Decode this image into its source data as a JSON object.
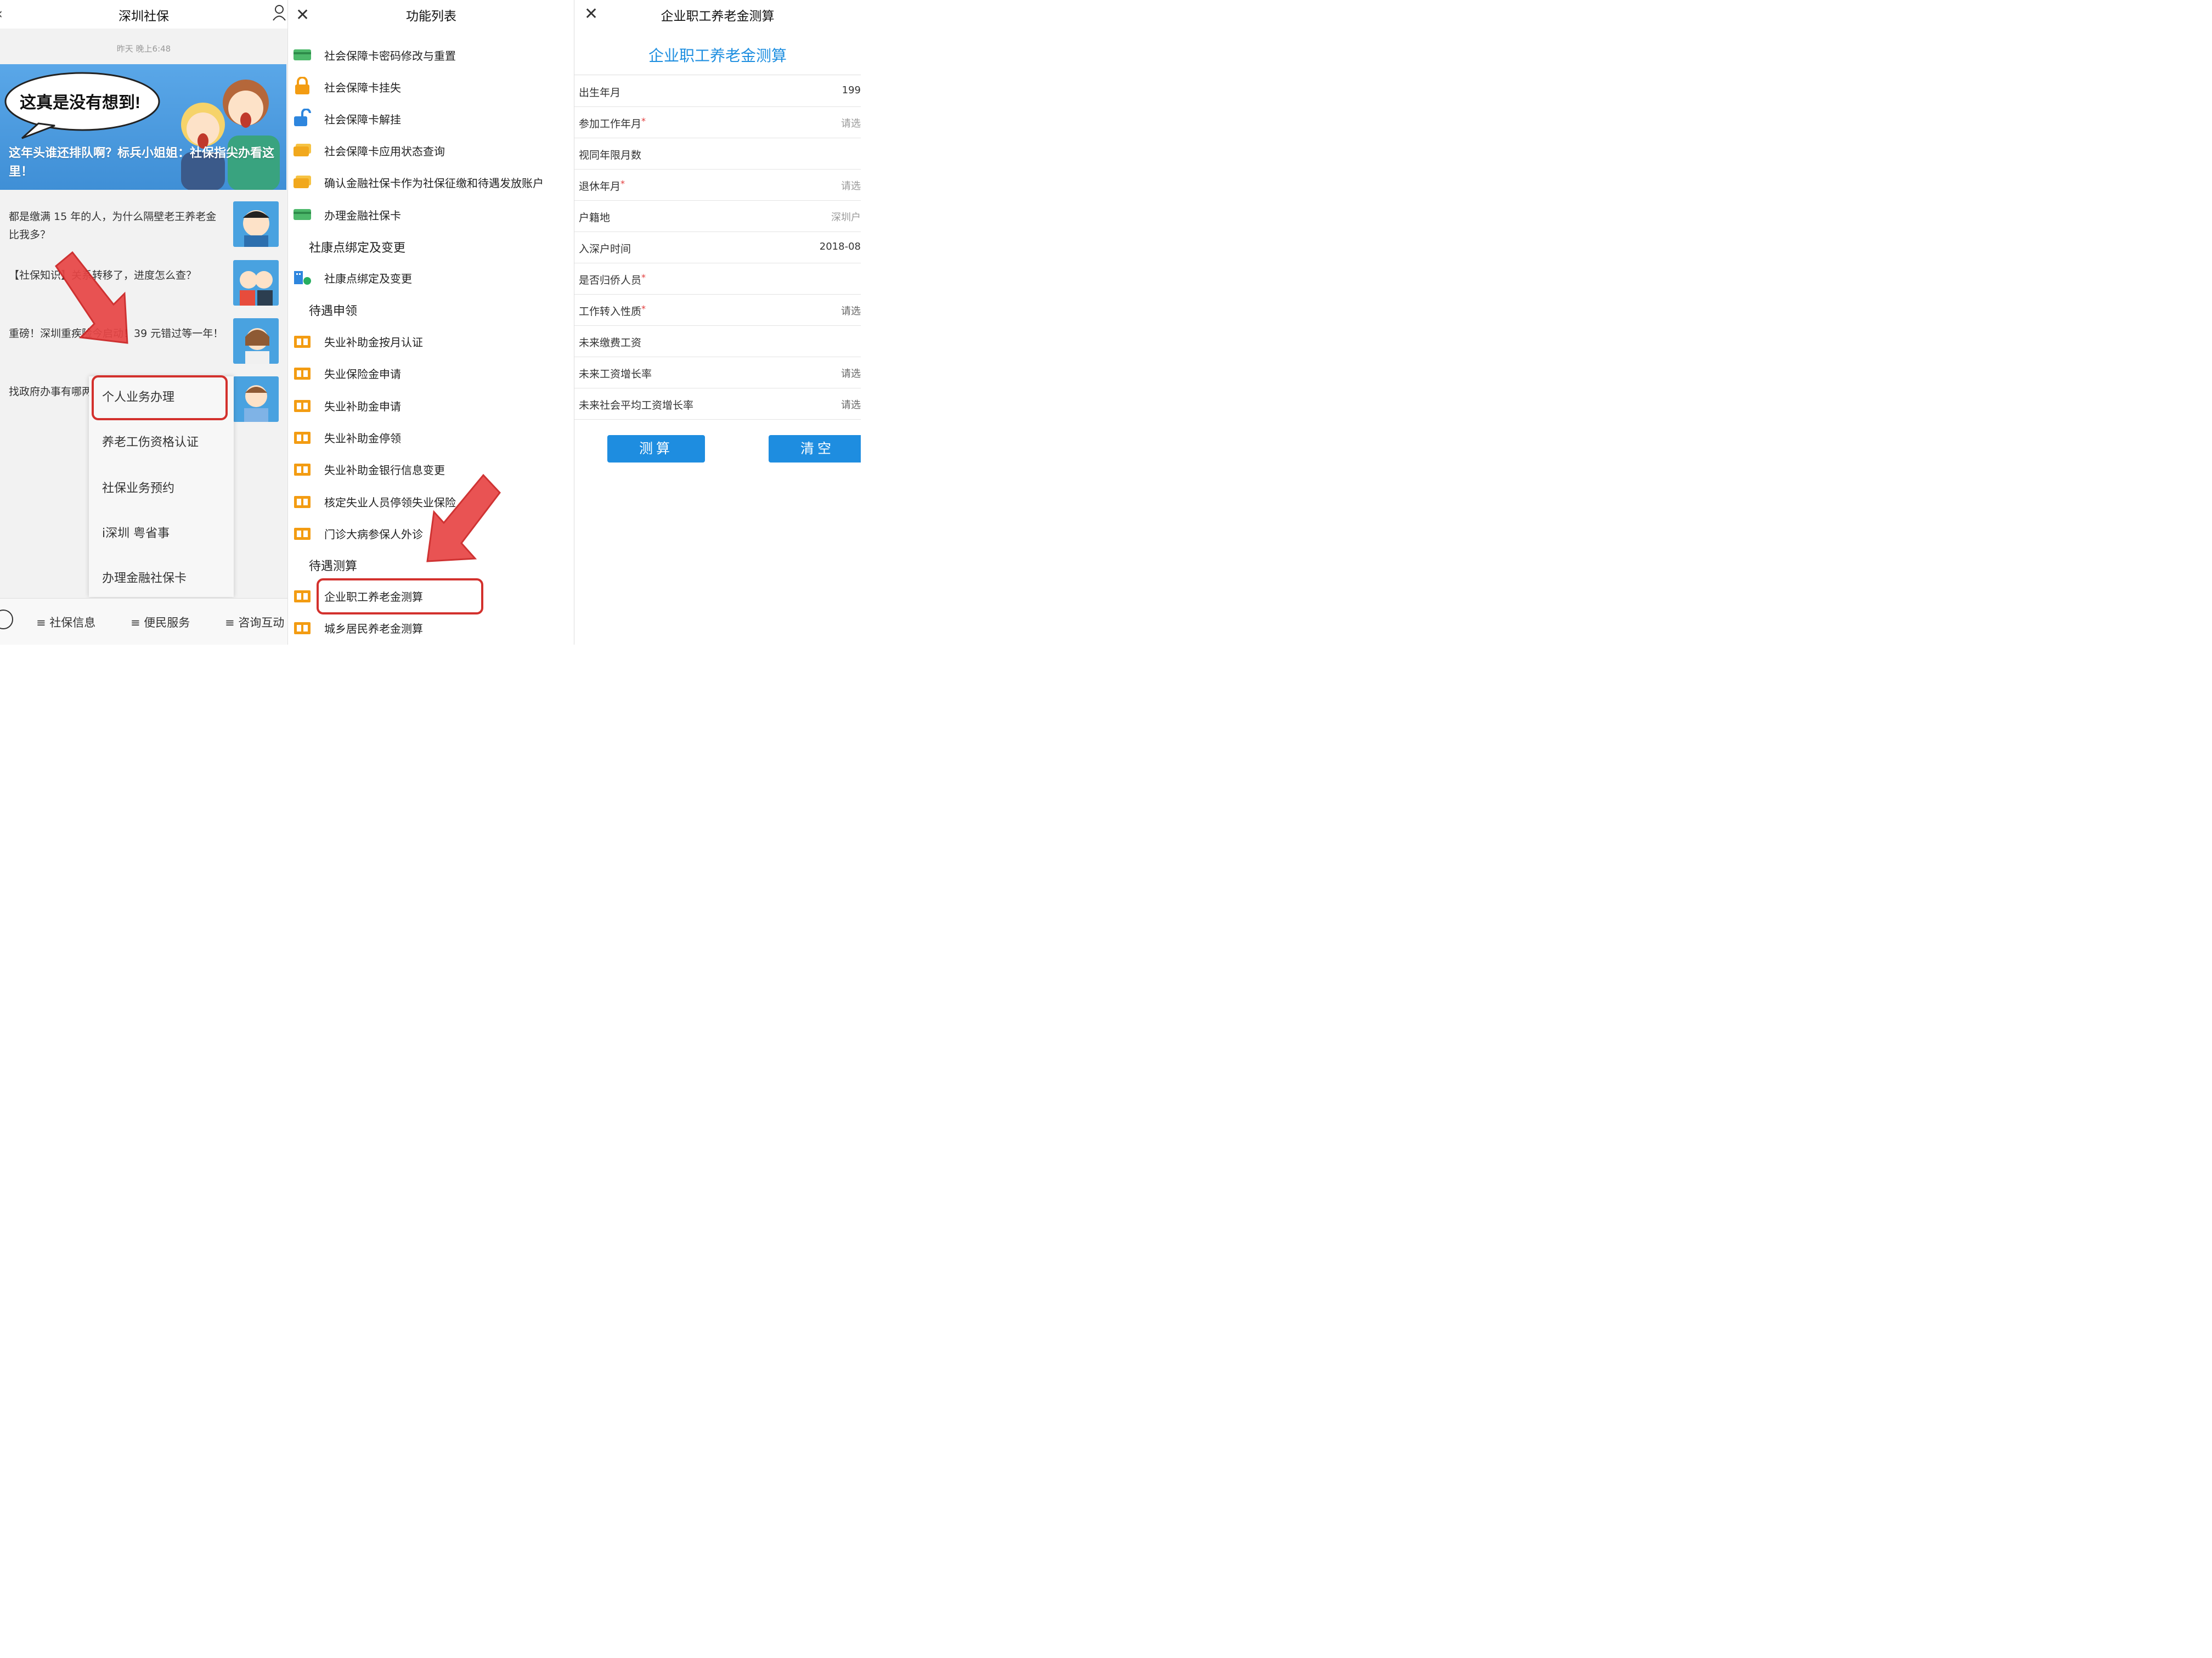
{
  "colors": {
    "accent": "#1f8fe0",
    "highlight": "#d3312d",
    "banner": "#4a9be0"
  },
  "panel1": {
    "title": "深圳社保",
    "timestamp": "昨天 晚上6:48",
    "banner_bubble": "这真是没有想到!",
    "banner_caption": "这年头谁还排队啊？标兵小姐姐：社保指尖办看这里！",
    "news": [
      {
        "text": "都是缴满 15 年的人，为什么隔壁老王养老金比我多？"
      },
      {
        "text": "【社保知识】关系转移了，进度怎么查？"
      },
      {
        "text": "重磅！深圳重疾险今启动！39 元错过等一年！"
      },
      {
        "text": "找政府办事有哪两句！"
      }
    ],
    "dropdown": [
      "个人业务办理",
      "养老工伤资格认证",
      "社保业务预约",
      "i深圳 粤省事",
      "办理金融社保卡"
    ],
    "bottom_tabs": [
      "≡ 社保信息",
      "≡ 便民服务",
      "≡ 咨询互动"
    ]
  },
  "panel2": {
    "title": "功能列表",
    "items": [
      {
        "label": "社会保障卡密码修改与重置",
        "icon": "green-card-icon"
      },
      {
        "label": "社会保障卡挂失",
        "icon": "orange-lock-icon"
      },
      {
        "label": "社会保障卡解挂",
        "icon": "blue-unlock-icon"
      },
      {
        "label": "社会保障卡应用状态查询",
        "icon": "yellow-card-icon"
      },
      {
        "label": "确认金融社保卡作为社保征缴和待遇发放账户",
        "icon": "yellow-card-icon"
      },
      {
        "label": "办理金融社保卡",
        "icon": "green-card-icon"
      }
    ],
    "section_health": "社康点绑定及变更",
    "health_item": "社康点绑定及变更",
    "section_benefit": "待遇申领",
    "benefit_items": [
      "失业补助金按月认证",
      "失业保险金申请",
      "失业补助金申请",
      "失业补助金停领",
      "失业补助金银行信息变更",
      "核定失业人员停领失业保险",
      "门诊大病参保人外诊"
    ],
    "section_calc": "待遇测算",
    "calc_items": [
      "企业职工养老金测算",
      "城乡居民养老金测算"
    ]
  },
  "panel3": {
    "title": "企业职工养老金测算",
    "form_title": "企业职工养老金测算",
    "rows": [
      {
        "label": "出生年月",
        "required": false,
        "value": "199",
        "value_color": "#333"
      },
      {
        "label": "参加工作年月",
        "required": true,
        "value": "请选",
        "value_color": "#999"
      },
      {
        "label": "视同年限月数",
        "required": false,
        "value": "",
        "value_color": "#999"
      },
      {
        "label": "退休年月",
        "required": true,
        "value": "请选",
        "value_color": "#999"
      },
      {
        "label": "户籍地",
        "required": false,
        "value": "深圳户",
        "value_color": "#999"
      },
      {
        "label": "入深户时间",
        "required": false,
        "value": "2018-08",
        "value_color": "#333"
      },
      {
        "label": "是否归侨人员",
        "required": true,
        "value": "",
        "value_color": "#999"
      },
      {
        "label": "工作转入性质",
        "required": true,
        "value": "请选",
        "value_color": "#666"
      },
      {
        "label": "未来缴费工资",
        "required": false,
        "value": "",
        "value_color": "#999"
      },
      {
        "label": "未来工资增长率",
        "required": false,
        "value": "请选",
        "value_color": "#666"
      },
      {
        "label": "未来社会平均工资增长率",
        "required": false,
        "value": "请选",
        "value_color": "#666"
      }
    ],
    "calc_button": "测算",
    "clear_button": "清空"
  }
}
